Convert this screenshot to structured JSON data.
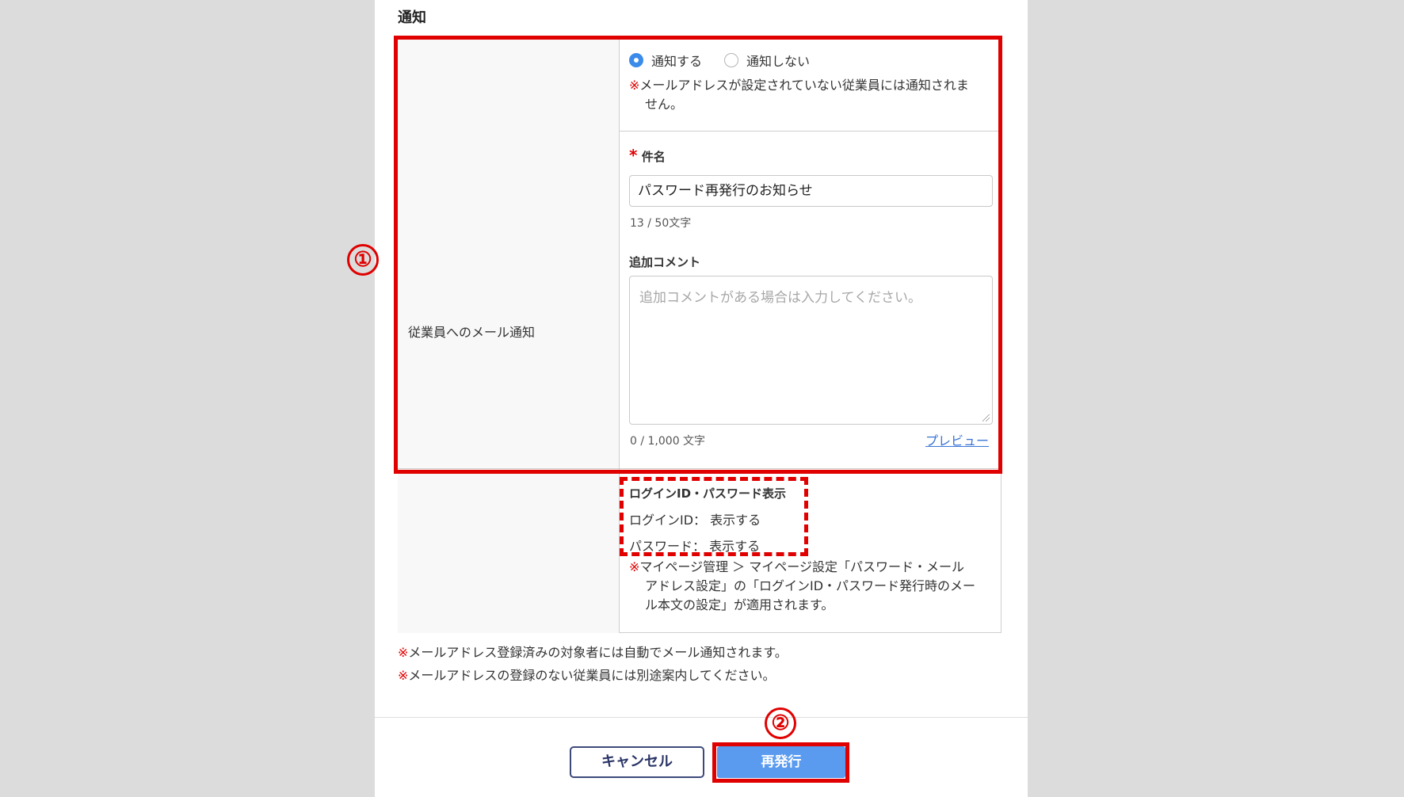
{
  "section": {
    "title": "通知"
  },
  "row": {
    "label": "従業員へのメール通知"
  },
  "notification": {
    "radio_notify": "通知する",
    "radio_no_notify": "通知しない",
    "selected": "通知する",
    "note_mark": "※",
    "note_line1": "メールアドレスが設定されていない従業員には通知されま",
    "note_line2": "せん。"
  },
  "subject": {
    "required_mark": "*",
    "label": "件名",
    "value": "パスワード再発行のお知らせ",
    "counter": "13 / 50文字"
  },
  "comment": {
    "label": "追加コメント",
    "placeholder": "追加コメントがある場合は入力してください。",
    "counter": "0 / 1,000 文字",
    "preview_link": "プレビュー"
  },
  "login_display": {
    "title": "ログインID・パスワード表示",
    "login_id_line": "ログインID： 表示する",
    "password_line": "パスワード： 表示する",
    "note_mark": "※",
    "note_line1": "マイページ管理 ＞ マイページ設定「パスワード・メール",
    "note_line2": "アドレス設定」の「ログインID・パスワード発行時のメー",
    "note_line3": "ル本文の設定」が適用されます。"
  },
  "footer_notes": {
    "mark": "※",
    "line1": "メールアドレス登録済みの対象者には自動でメール通知されます。",
    "line2": "メールアドレスの登録のない従業員には別途案内してください。"
  },
  "buttons": {
    "cancel": "キャンセル",
    "reissue": "再発行"
  },
  "annotations": {
    "marker1": "①",
    "marker2": "②"
  },
  "colors": {
    "annotation_red": "#e00000",
    "primary_button": "#5a9bf0",
    "radio_checked": "#3a8bea",
    "link": "#3a74d6"
  }
}
